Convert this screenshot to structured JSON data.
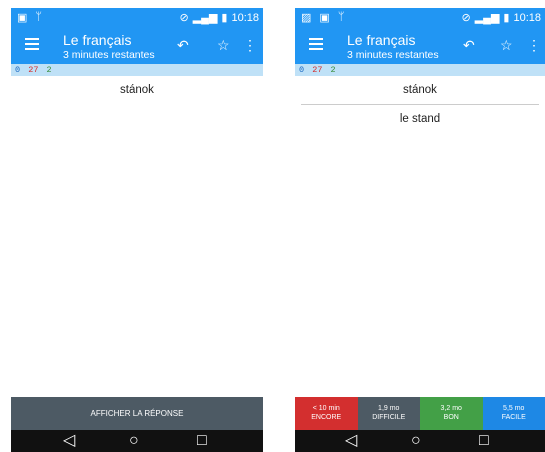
{
  "status": {
    "time": "10:18"
  },
  "app": {
    "title": "Le français",
    "subtitle": "3 minutes restantes"
  },
  "counts": {
    "new": "0",
    "learning": "27",
    "review": "2"
  },
  "card": {
    "front": "stánok",
    "back": "le stand"
  },
  "buttons": {
    "show_answer": "AFFICHER LA RÉPONSE",
    "again": {
      "time": "< 10 min",
      "label": "ENCORE",
      "color": "#d32f2f"
    },
    "hard": {
      "time": "1,9 mo",
      "label": "DIFFICILE",
      "color": "#4d5a64"
    },
    "good": {
      "time": "3,2 mo",
      "label": "BON",
      "color": "#43a047"
    },
    "easy": {
      "time": "5,5 mo",
      "label": "FACILE",
      "color": "#1e88e5"
    }
  },
  "icons": {
    "menu": "hamburger-icon",
    "undo": "undo-icon",
    "star": "star-icon",
    "more": "overflow-icon",
    "back": "back-icon",
    "home": "home-icon",
    "recent": "recent-apps-icon"
  },
  "colors": {
    "primary": "#2196f3",
    "count_bar": "#bfe1f7"
  }
}
